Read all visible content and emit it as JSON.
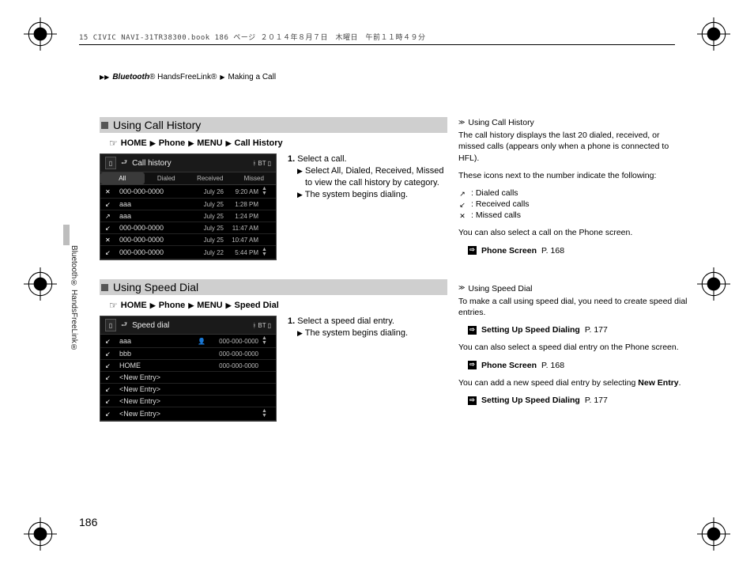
{
  "header_line": "15 CIVIC NAVI-31TR38300.book  186 ページ  ２０１４年８月７日　木曜日　午前１１時４９分",
  "breadcrumb": {
    "a": "Bluetooth",
    "a_reg": "®",
    "b": "HandsFreeLink®",
    "c": "Making a Call"
  },
  "vertical_label": "Bluetooth® HandsFreeLink®",
  "page_number": "186",
  "section1": {
    "title": "Using Call History",
    "nav": {
      "home": "HOME",
      "phone": "Phone",
      "menu": "MENU",
      "last": "Call History"
    },
    "device_title": "Call history",
    "bt_label": "BT",
    "tabs": {
      "all": "All",
      "dialed": "Dialed",
      "received": "Received",
      "missed": "Missed"
    },
    "rows": [
      {
        "icon": "✕",
        "name": "000-000-0000",
        "date": "July 26",
        "time": "9:20 AM"
      },
      {
        "icon": "↙",
        "name": "aaa",
        "date": "July 25",
        "time": "1:28 PM"
      },
      {
        "icon": "↗",
        "name": "aaa",
        "date": "July 25",
        "time": "1:24 PM"
      },
      {
        "icon": "↙",
        "name": "000-000-0000",
        "date": "July 25",
        "time": "11:47 AM"
      },
      {
        "icon": "✕",
        "name": "000-000-0000",
        "date": "July 25",
        "time": "10:47 AM"
      },
      {
        "icon": "↙",
        "name": "000-000-0000",
        "date": "July 22",
        "time": "5:44 PM"
      }
    ],
    "steps": {
      "s1_num": "1.",
      "s1_text": "Select a call.",
      "s1_sub1a": "Select ",
      "s1_sub1_all": "All",
      "s1_sub1_dialed": "Dialed",
      "s1_sub1_received": "Received",
      "s1_sub1_missed": "Missed",
      "s1_sub1b": " to view the call history by category.",
      "s1_sub2": "The system begins dialing."
    },
    "notes": {
      "title": "Using Call History",
      "p1": "The call history displays the last 20 dialed, received, or missed calls (appears only when a phone is connected to HFL).",
      "p2": "These icons next to the number indicate the following:",
      "dialed": ": Dialed calls",
      "received": ": Received calls",
      "missed": ": Missed calls",
      "p3": "You can also select a call on the Phone screen.",
      "ref_label": "Phone Screen",
      "ref_page": "P. 168"
    }
  },
  "section2": {
    "title": "Using Speed Dial",
    "nav": {
      "home": "HOME",
      "phone": "Phone",
      "menu": "MENU",
      "last": "Speed Dial"
    },
    "device_title": "Speed dial",
    "bt_label": "BT",
    "rows": [
      {
        "icon": "↙",
        "name": "aaa",
        "vicon": "👤",
        "num": "000-000-0000"
      },
      {
        "icon": "↙",
        "name": "bbb",
        "vicon": "",
        "num": "000-000-0000"
      },
      {
        "icon": "↙",
        "name": "HOME",
        "vicon": "",
        "num": "000-000-0000"
      },
      {
        "icon": "↙",
        "name": "<New Entry>",
        "vicon": "",
        "num": ""
      },
      {
        "icon": "↙",
        "name": "<New Entry>",
        "vicon": "",
        "num": ""
      },
      {
        "icon": "↙",
        "name": "<New Entry>",
        "vicon": "",
        "num": ""
      },
      {
        "icon": "↙",
        "name": "<New Entry>",
        "vicon": "",
        "num": ""
      }
    ],
    "steps": {
      "s1_num": "1.",
      "s1_text": "Select a speed dial entry.",
      "s1_sub1": "The system begins dialing."
    },
    "notes": {
      "title": "Using Speed Dial",
      "p1": "To make a call using speed dial, you need to create speed dial entries.",
      "ref1_label": "Setting Up Speed Dialing",
      "ref1_page": "P. 177",
      "p2": "You can also select a speed dial entry on the Phone screen.",
      "ref2_label": "Phone Screen",
      "ref2_page": "P. 168",
      "p3a": "You can add a new speed dial entry by selecting ",
      "p3_new": "New Entry",
      "p3b": ".",
      "ref3_label": "Setting Up Speed Dialing",
      "ref3_page": "P. 177"
    }
  },
  "glyphs": {
    "comma": ", "
  }
}
